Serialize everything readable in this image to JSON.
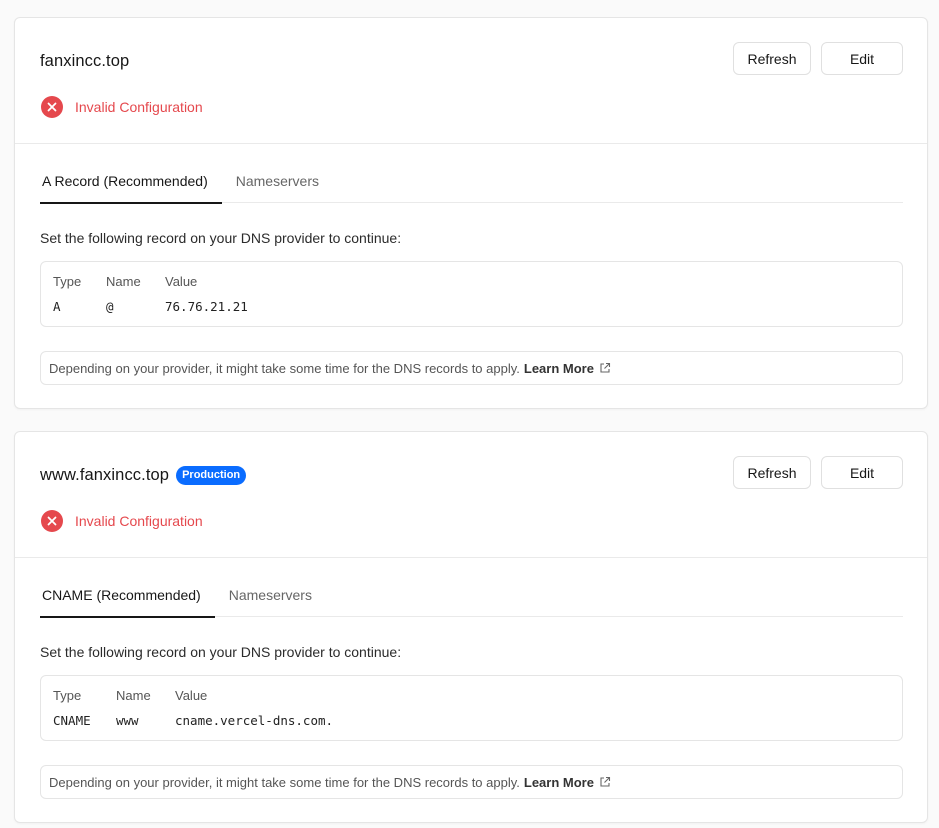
{
  "domains": [
    {
      "name": "fanxincc.top",
      "badge": "",
      "refresh_label": "Refresh",
      "edit_label": "Edit",
      "status": "Invalid Configuration",
      "tabs": [
        "A Record (Recommended)",
        "Nameservers"
      ],
      "instruction": "Set the following record on your DNS provider to continue:",
      "record": {
        "type_header": "Type",
        "name_header": "Name",
        "value_header": "Value",
        "type": "A",
        "name": "@",
        "value": "76.76.21.21"
      },
      "note": "Depending on your provider, it might take some time for the DNS records to apply.",
      "learn_more": "Learn More"
    },
    {
      "name": "www.fanxincc.top",
      "badge": "Production",
      "refresh_label": "Refresh",
      "edit_label": "Edit",
      "status": "Invalid Configuration",
      "tabs": [
        "CNAME (Recommended)",
        "Nameservers"
      ],
      "instruction": "Set the following record on your DNS provider to continue:",
      "record": {
        "type_header": "Type",
        "name_header": "Name",
        "value_header": "Value",
        "type": "CNAME",
        "name": "www",
        "value": "cname.vercel-dns.com."
      },
      "note": "Depending on your provider, it might take some time for the DNS records to apply.",
      "learn_more": "Learn More"
    }
  ],
  "colors": {
    "error": "#e5484d",
    "badge": "#0a6cff",
    "text": "#171717"
  },
  "icons": {
    "status": "close-circle-icon",
    "learn_more": "external-link-icon"
  }
}
